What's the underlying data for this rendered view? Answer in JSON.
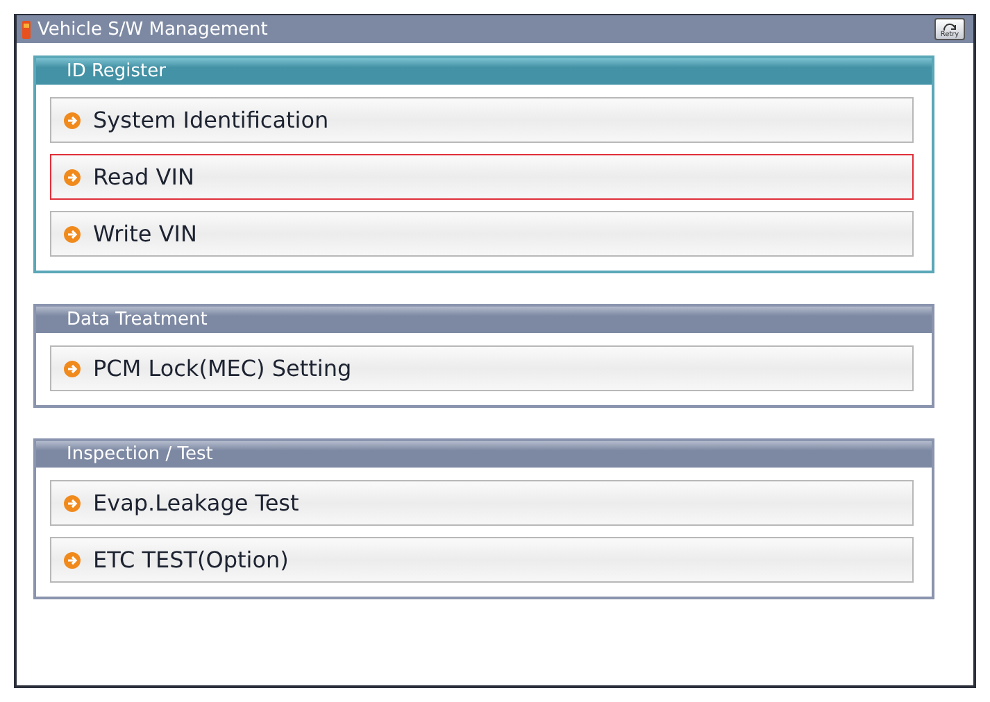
{
  "window": {
    "title": "Vehicle S/W Management",
    "retry_label": "Retry"
  },
  "sections": [
    {
      "title": "ID Register",
      "active": true,
      "items": [
        {
          "label": "System Identification",
          "selected": false
        },
        {
          "label": "Read VIN",
          "selected": true
        },
        {
          "label": "Write VIN",
          "selected": false
        }
      ]
    },
    {
      "title": "Data Treatment",
      "active": false,
      "items": [
        {
          "label": "PCM Lock(MEC) Setting",
          "selected": false
        }
      ]
    },
    {
      "title": "Inspection / Test",
      "active": false,
      "items": [
        {
          "label": "Evap.Leakage Test",
          "selected": false
        },
        {
          "label": "ETC TEST(Option)",
          "selected": false
        }
      ]
    }
  ]
}
